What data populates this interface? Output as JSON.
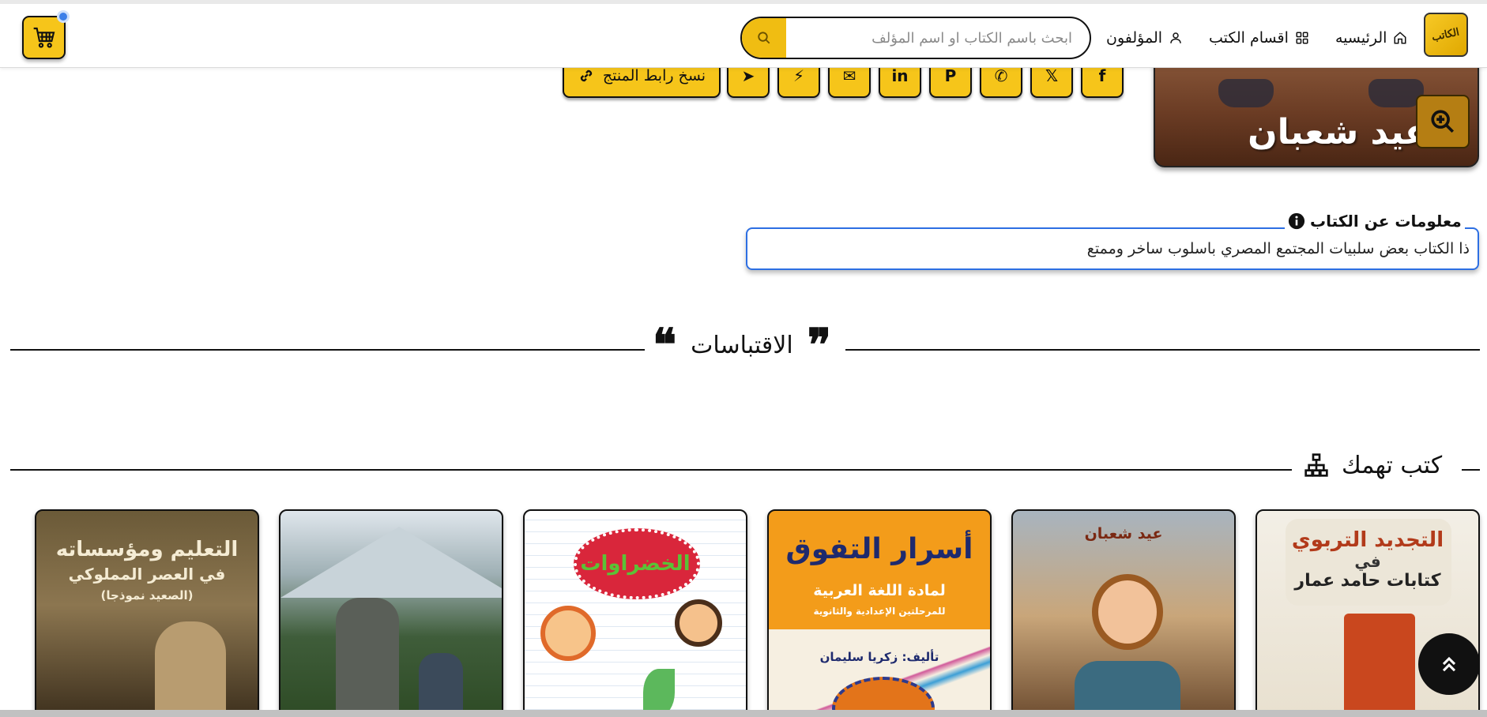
{
  "nav": {
    "logo_text": "الكاتب",
    "home_label": "الرئيسيه",
    "categories_label": "اقسام الكتب",
    "authors_label": "المؤلفون",
    "search_placeholder": "ابحث باسم الكتاب او اسم المؤلف"
  },
  "cover": {
    "author_text": "عيد شعبان"
  },
  "share": {
    "buttons": [
      {
        "name": "facebook",
        "glyph": "f"
      },
      {
        "name": "x",
        "glyph": "𝕏"
      },
      {
        "name": "whatsapp",
        "glyph": "✆"
      },
      {
        "name": "pinterest",
        "glyph": "P"
      },
      {
        "name": "linkedin",
        "glyph": "in"
      },
      {
        "name": "email",
        "glyph": "✉"
      },
      {
        "name": "messenger",
        "glyph": "⚡"
      },
      {
        "name": "telegram",
        "glyph": "➤"
      }
    ],
    "copy_link_label": "نسخ رابط المنتج"
  },
  "book_info": {
    "title": "معلومات عن الكتاب",
    "description": "ذا الكتاب بعض سلبيات المجتمع المصري باسلوب ساخر وممتع"
  },
  "quotes": {
    "heading": "الاقتباسات"
  },
  "related": {
    "heading": "كتب تهمك",
    "books": [
      {
        "title": "التجديد التربوي",
        "subtitle": "في",
        "extra": "كتابات حامد عمار"
      },
      {
        "title": "عيد شعبان",
        "subtitle": "",
        "extra": ""
      },
      {
        "title": "أسرار التفوق",
        "subtitle": "لمادة اللغة العربية",
        "extra": "للمرحلتين الإعدادية والثانوية",
        "author": "تأليف: زكريا سليمان"
      },
      {
        "title": "الخضراوات",
        "subtitle": "",
        "extra": ""
      },
      {
        "title": "",
        "subtitle": "",
        "extra": ""
      },
      {
        "title": "التعليم ومؤسساته",
        "subtitle": "في العصر المملوكي",
        "extra": "(الصعيد نموذجا)"
      }
    ]
  },
  "colors": {
    "accent": "#f6c51a",
    "border": "#111111",
    "info_border": "#2d6fe3",
    "cart_badge": "#3d7fe8"
  }
}
